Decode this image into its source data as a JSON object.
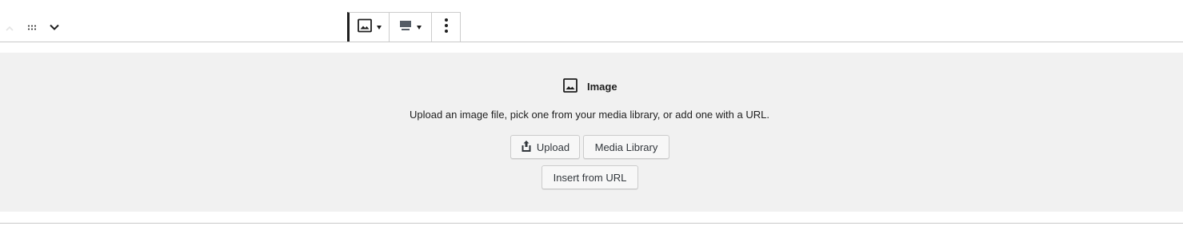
{
  "toolbar": {
    "mover_up_icon": "chevron-up-icon",
    "drag_handle_icon": "drag-handle-icon",
    "mover_down_icon": "chevron-down-icon",
    "block_type_icon": "image-icon",
    "align_icon": "align-icon",
    "more_icon": "more-vertical-icon"
  },
  "placeholder": {
    "icon": "image-icon",
    "label": "Image",
    "instructions": "Upload an image file, pick one from your media library, or add one with a URL.",
    "upload_label": "Upload",
    "media_library_label": "Media Library",
    "insert_url_label": "Insert from URL"
  },
  "colors": {
    "panel_bg": "#f1f1f1",
    "text": "#1e1e1e",
    "border": "#cccccc"
  }
}
